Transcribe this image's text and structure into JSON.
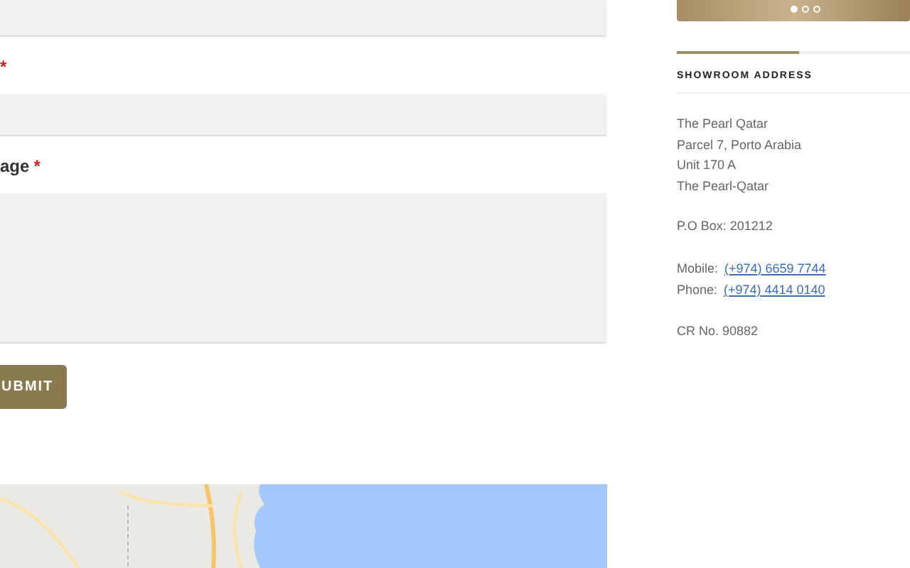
{
  "form": {
    "fields": [
      {
        "kind": "input"
      },
      {
        "kind": "input",
        "required_mark": "*"
      },
      {
        "kind": "textarea",
        "label": "age",
        "required_mark": "*"
      }
    ],
    "submit": "UBMIT"
  },
  "sidebar": {
    "slider_dots": [
      {
        "selected": true
      },
      {
        "selected": false
      },
      {
        "selected": false
      }
    ],
    "heading": "SHOWROOM ADDRESS",
    "address": [
      "The Pearl Qatar",
      "Parcel 7, Porto Arabia",
      "Unit 170 A",
      "The Pearl-Qatar"
    ],
    "po_box": "P.O Box: 201212",
    "contacts": [
      {
        "label": "Mobile:",
        "link": "(+974) 6659 7744"
      },
      {
        "label": "Phone:",
        "link": "(+974) 4414 0140"
      }
    ],
    "cr": "CR No. 90882"
  }
}
